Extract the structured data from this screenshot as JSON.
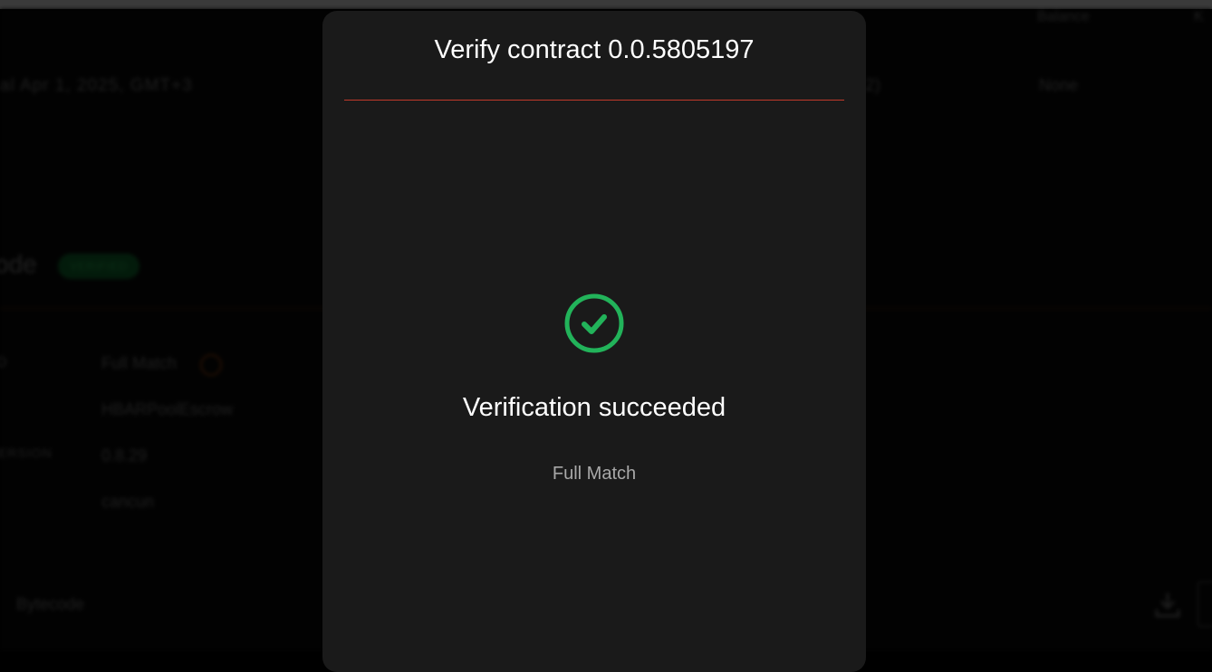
{
  "background": {
    "date_text": "al  Apr 1, 2025, GMT+3",
    "paren_text": "2)",
    "none_text": "None",
    "top_right_1": "Balance",
    "top_right_2": "K",
    "section_title": "ode",
    "verified_badge": "VERIFIED",
    "row_keys": [
      "D",
      "ERSION"
    ],
    "row_values": [
      "Full Match",
      "HBARPoolEscrow",
      "0.8.29",
      "cancun"
    ],
    "bytecode_label": "Bytecode",
    "download_icon": "download-icon"
  },
  "modal": {
    "title": "Verify contract 0.0.5805197",
    "status_icon": "check-circle-icon",
    "status_heading": "Verification succeeded",
    "status_detail": "Full Match"
  },
  "colors": {
    "modal_bg": "#1a1a1a",
    "success": "#22b35a",
    "divider": "#c0392b"
  }
}
